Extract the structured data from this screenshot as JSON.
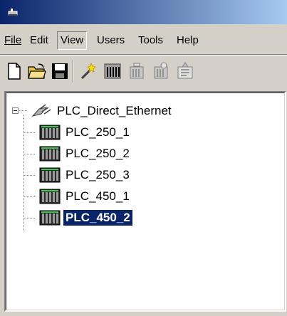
{
  "menu": {
    "file": "File",
    "edit": "Edit",
    "view": "View",
    "users": "Users",
    "tools": "Tools",
    "help": "Help"
  },
  "toolbar": {
    "icons": [
      "new-file-icon",
      "open-folder-icon",
      "save-icon",
      "wizard-icon",
      "plc-device-icon",
      "plc-add-icon",
      "plc-remove-icon",
      "properties-icon"
    ]
  },
  "tree": {
    "root": "PLC_Direct_Ethernet",
    "children": [
      "PLC_250_1",
      "PLC_250_2",
      "PLC_250_3",
      "PLC_450_1",
      "PLC_450_2"
    ],
    "selected_index": 4
  },
  "colors": {
    "titlebar_start": "#0a246a",
    "titlebar_end": "#a6caf0",
    "selection": "#0a246a",
    "chrome": "#d4d0c8"
  }
}
